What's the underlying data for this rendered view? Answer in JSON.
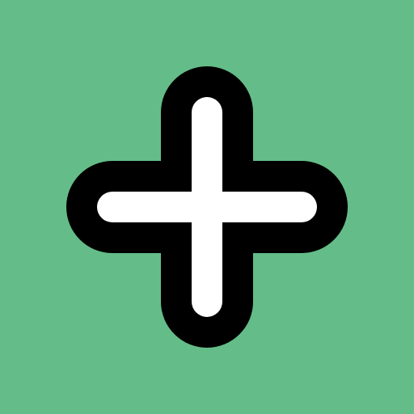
{
  "icon": {
    "name": "plus-icon"
  },
  "colors": {
    "background": "#64bd88",
    "outline": "#000000",
    "fill": "#ffffff"
  }
}
